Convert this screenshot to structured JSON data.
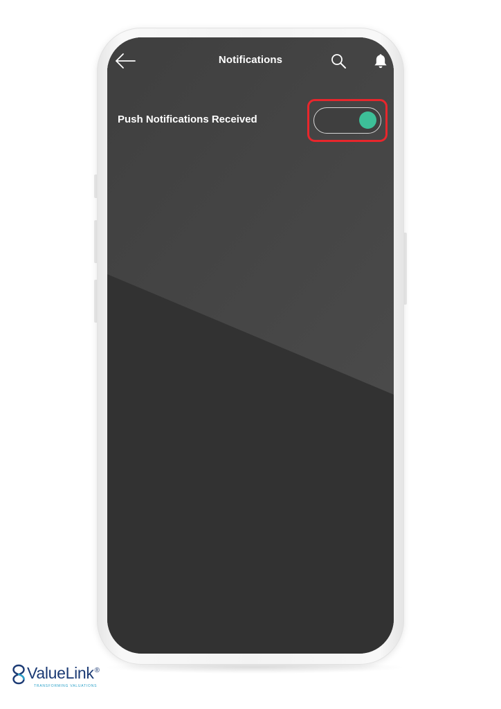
{
  "header": {
    "title": "Notifications",
    "back_icon": "arrow-left-icon",
    "search_icon": "search-icon",
    "bell_icon": "bell-icon"
  },
  "settings": {
    "push_notifications": {
      "label": "Push Notifications Received",
      "enabled": true
    }
  },
  "brand": {
    "name": "ValueLink",
    "registered": "®",
    "tagline": "TRANSFORMING VALUATIONS"
  },
  "colors": {
    "screen_background": "#323232",
    "screen_highlight": "#484848",
    "toggle_on": "#3dbf98",
    "highlight_outline": "#e8262c",
    "brand_primary": "#1b3a74",
    "brand_accent": "#2aa0c8"
  }
}
